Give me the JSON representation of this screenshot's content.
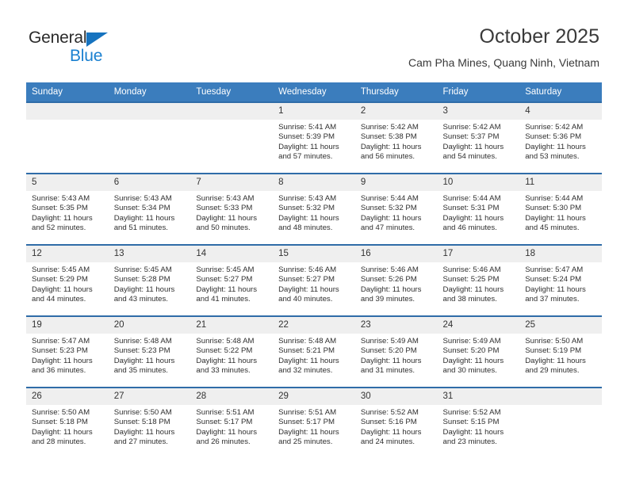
{
  "brand": {
    "name_part1": "General",
    "name_part2": "Blue",
    "triangle_color": "#1673bf",
    "blue_color": "#1a80d0"
  },
  "header": {
    "title": "October 2025",
    "subtitle": "Cam Pha Mines, Quang Ninh, Vietnam",
    "header_bg": "#3b7dbd",
    "row_divider": "#2f6ca8",
    "daynum_bg": "#efefef"
  },
  "weekdays": [
    "Sunday",
    "Monday",
    "Tuesday",
    "Wednesday",
    "Thursday",
    "Friday",
    "Saturday"
  ],
  "weeks": [
    [
      {
        "day": "",
        "sunrise": "",
        "sunset": "",
        "daylight1": "",
        "daylight2": ""
      },
      {
        "day": "",
        "sunrise": "",
        "sunset": "",
        "daylight1": "",
        "daylight2": ""
      },
      {
        "day": "",
        "sunrise": "",
        "sunset": "",
        "daylight1": "",
        "daylight2": ""
      },
      {
        "day": "1",
        "sunrise": "Sunrise: 5:41 AM",
        "sunset": "Sunset: 5:39 PM",
        "daylight1": "Daylight: 11 hours",
        "daylight2": "and 57 minutes."
      },
      {
        "day": "2",
        "sunrise": "Sunrise: 5:42 AM",
        "sunset": "Sunset: 5:38 PM",
        "daylight1": "Daylight: 11 hours",
        "daylight2": "and 56 minutes."
      },
      {
        "day": "3",
        "sunrise": "Sunrise: 5:42 AM",
        "sunset": "Sunset: 5:37 PM",
        "daylight1": "Daylight: 11 hours",
        "daylight2": "and 54 minutes."
      },
      {
        "day": "4",
        "sunrise": "Sunrise: 5:42 AM",
        "sunset": "Sunset: 5:36 PM",
        "daylight1": "Daylight: 11 hours",
        "daylight2": "and 53 minutes."
      }
    ],
    [
      {
        "day": "5",
        "sunrise": "Sunrise: 5:43 AM",
        "sunset": "Sunset: 5:35 PM",
        "daylight1": "Daylight: 11 hours",
        "daylight2": "and 52 minutes."
      },
      {
        "day": "6",
        "sunrise": "Sunrise: 5:43 AM",
        "sunset": "Sunset: 5:34 PM",
        "daylight1": "Daylight: 11 hours",
        "daylight2": "and 51 minutes."
      },
      {
        "day": "7",
        "sunrise": "Sunrise: 5:43 AM",
        "sunset": "Sunset: 5:33 PM",
        "daylight1": "Daylight: 11 hours",
        "daylight2": "and 50 minutes."
      },
      {
        "day": "8",
        "sunrise": "Sunrise: 5:43 AM",
        "sunset": "Sunset: 5:32 PM",
        "daylight1": "Daylight: 11 hours",
        "daylight2": "and 48 minutes."
      },
      {
        "day": "9",
        "sunrise": "Sunrise: 5:44 AM",
        "sunset": "Sunset: 5:32 PM",
        "daylight1": "Daylight: 11 hours",
        "daylight2": "and 47 minutes."
      },
      {
        "day": "10",
        "sunrise": "Sunrise: 5:44 AM",
        "sunset": "Sunset: 5:31 PM",
        "daylight1": "Daylight: 11 hours",
        "daylight2": "and 46 minutes."
      },
      {
        "day": "11",
        "sunrise": "Sunrise: 5:44 AM",
        "sunset": "Sunset: 5:30 PM",
        "daylight1": "Daylight: 11 hours",
        "daylight2": "and 45 minutes."
      }
    ],
    [
      {
        "day": "12",
        "sunrise": "Sunrise: 5:45 AM",
        "sunset": "Sunset: 5:29 PM",
        "daylight1": "Daylight: 11 hours",
        "daylight2": "and 44 minutes."
      },
      {
        "day": "13",
        "sunrise": "Sunrise: 5:45 AM",
        "sunset": "Sunset: 5:28 PM",
        "daylight1": "Daylight: 11 hours",
        "daylight2": "and 43 minutes."
      },
      {
        "day": "14",
        "sunrise": "Sunrise: 5:45 AM",
        "sunset": "Sunset: 5:27 PM",
        "daylight1": "Daylight: 11 hours",
        "daylight2": "and 41 minutes."
      },
      {
        "day": "15",
        "sunrise": "Sunrise: 5:46 AM",
        "sunset": "Sunset: 5:27 PM",
        "daylight1": "Daylight: 11 hours",
        "daylight2": "and 40 minutes."
      },
      {
        "day": "16",
        "sunrise": "Sunrise: 5:46 AM",
        "sunset": "Sunset: 5:26 PM",
        "daylight1": "Daylight: 11 hours",
        "daylight2": "and 39 minutes."
      },
      {
        "day": "17",
        "sunrise": "Sunrise: 5:46 AM",
        "sunset": "Sunset: 5:25 PM",
        "daylight1": "Daylight: 11 hours",
        "daylight2": "and 38 minutes."
      },
      {
        "day": "18",
        "sunrise": "Sunrise: 5:47 AM",
        "sunset": "Sunset: 5:24 PM",
        "daylight1": "Daylight: 11 hours",
        "daylight2": "and 37 minutes."
      }
    ],
    [
      {
        "day": "19",
        "sunrise": "Sunrise: 5:47 AM",
        "sunset": "Sunset: 5:23 PM",
        "daylight1": "Daylight: 11 hours",
        "daylight2": "and 36 minutes."
      },
      {
        "day": "20",
        "sunrise": "Sunrise: 5:48 AM",
        "sunset": "Sunset: 5:23 PM",
        "daylight1": "Daylight: 11 hours",
        "daylight2": "and 35 minutes."
      },
      {
        "day": "21",
        "sunrise": "Sunrise: 5:48 AM",
        "sunset": "Sunset: 5:22 PM",
        "daylight1": "Daylight: 11 hours",
        "daylight2": "and 33 minutes."
      },
      {
        "day": "22",
        "sunrise": "Sunrise: 5:48 AM",
        "sunset": "Sunset: 5:21 PM",
        "daylight1": "Daylight: 11 hours",
        "daylight2": "and 32 minutes."
      },
      {
        "day": "23",
        "sunrise": "Sunrise: 5:49 AM",
        "sunset": "Sunset: 5:20 PM",
        "daylight1": "Daylight: 11 hours",
        "daylight2": "and 31 minutes."
      },
      {
        "day": "24",
        "sunrise": "Sunrise: 5:49 AM",
        "sunset": "Sunset: 5:20 PM",
        "daylight1": "Daylight: 11 hours",
        "daylight2": "and 30 minutes."
      },
      {
        "day": "25",
        "sunrise": "Sunrise: 5:50 AM",
        "sunset": "Sunset: 5:19 PM",
        "daylight1": "Daylight: 11 hours",
        "daylight2": "and 29 minutes."
      }
    ],
    [
      {
        "day": "26",
        "sunrise": "Sunrise: 5:50 AM",
        "sunset": "Sunset: 5:18 PM",
        "daylight1": "Daylight: 11 hours",
        "daylight2": "and 28 minutes."
      },
      {
        "day": "27",
        "sunrise": "Sunrise: 5:50 AM",
        "sunset": "Sunset: 5:18 PM",
        "daylight1": "Daylight: 11 hours",
        "daylight2": "and 27 minutes."
      },
      {
        "day": "28",
        "sunrise": "Sunrise: 5:51 AM",
        "sunset": "Sunset: 5:17 PM",
        "daylight1": "Daylight: 11 hours",
        "daylight2": "and 26 minutes."
      },
      {
        "day": "29",
        "sunrise": "Sunrise: 5:51 AM",
        "sunset": "Sunset: 5:17 PM",
        "daylight1": "Daylight: 11 hours",
        "daylight2": "and 25 minutes."
      },
      {
        "day": "30",
        "sunrise": "Sunrise: 5:52 AM",
        "sunset": "Sunset: 5:16 PM",
        "daylight1": "Daylight: 11 hours",
        "daylight2": "and 24 minutes."
      },
      {
        "day": "31",
        "sunrise": "Sunrise: 5:52 AM",
        "sunset": "Sunset: 5:15 PM",
        "daylight1": "Daylight: 11 hours",
        "daylight2": "and 23 minutes."
      },
      {
        "day": "",
        "sunrise": "",
        "sunset": "",
        "daylight1": "",
        "daylight2": ""
      }
    ]
  ]
}
